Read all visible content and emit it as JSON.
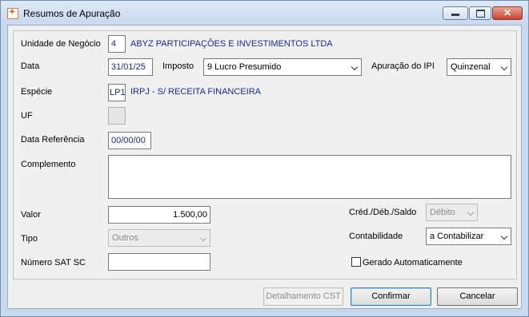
{
  "window": {
    "title": "Resumos de Apuração",
    "icon": "orange-app-icon"
  },
  "form": {
    "unidade": {
      "label": "Unidade de Negócio",
      "code": "4",
      "name": "ABYZ PARTICIPAÇÕES E INVESTIMENTOS LTDA"
    },
    "data": {
      "label": "Data",
      "value": "31/01/25"
    },
    "imposto": {
      "label": "Imposto",
      "value": "9 Lucro Presumido"
    },
    "apuracao_ipi": {
      "label": "Apuração do IPI",
      "value": "Quinzenal"
    },
    "especie": {
      "label": "Espécie",
      "code": "LP1",
      "name": "IRPJ - S/ RECEITA FINANCEIRA"
    },
    "uf": {
      "label": "UF",
      "value": ""
    },
    "data_referencia": {
      "label": "Data Referência",
      "value": "00/00/00"
    },
    "complemento": {
      "label": "Complemento",
      "value": ""
    },
    "valor": {
      "label": "Valor",
      "value": "1.500,00"
    },
    "cred_deb_saldo": {
      "label": "Créd./Déb./Saldo",
      "value": "Débito"
    },
    "tipo": {
      "label": "Tipo",
      "value": "Outros"
    },
    "contabilidade": {
      "label": "Contabilidade",
      "value": "a Contabilizar"
    },
    "numero_sat": {
      "label": "Número SAT SC",
      "value": ""
    },
    "gerado_auto": {
      "label": "Gerado Automaticamente",
      "checked": false
    }
  },
  "buttons": {
    "detalhamento": "Detalhamento CST",
    "confirmar": "Confirmar",
    "cancelar": "Cancelar"
  }
}
